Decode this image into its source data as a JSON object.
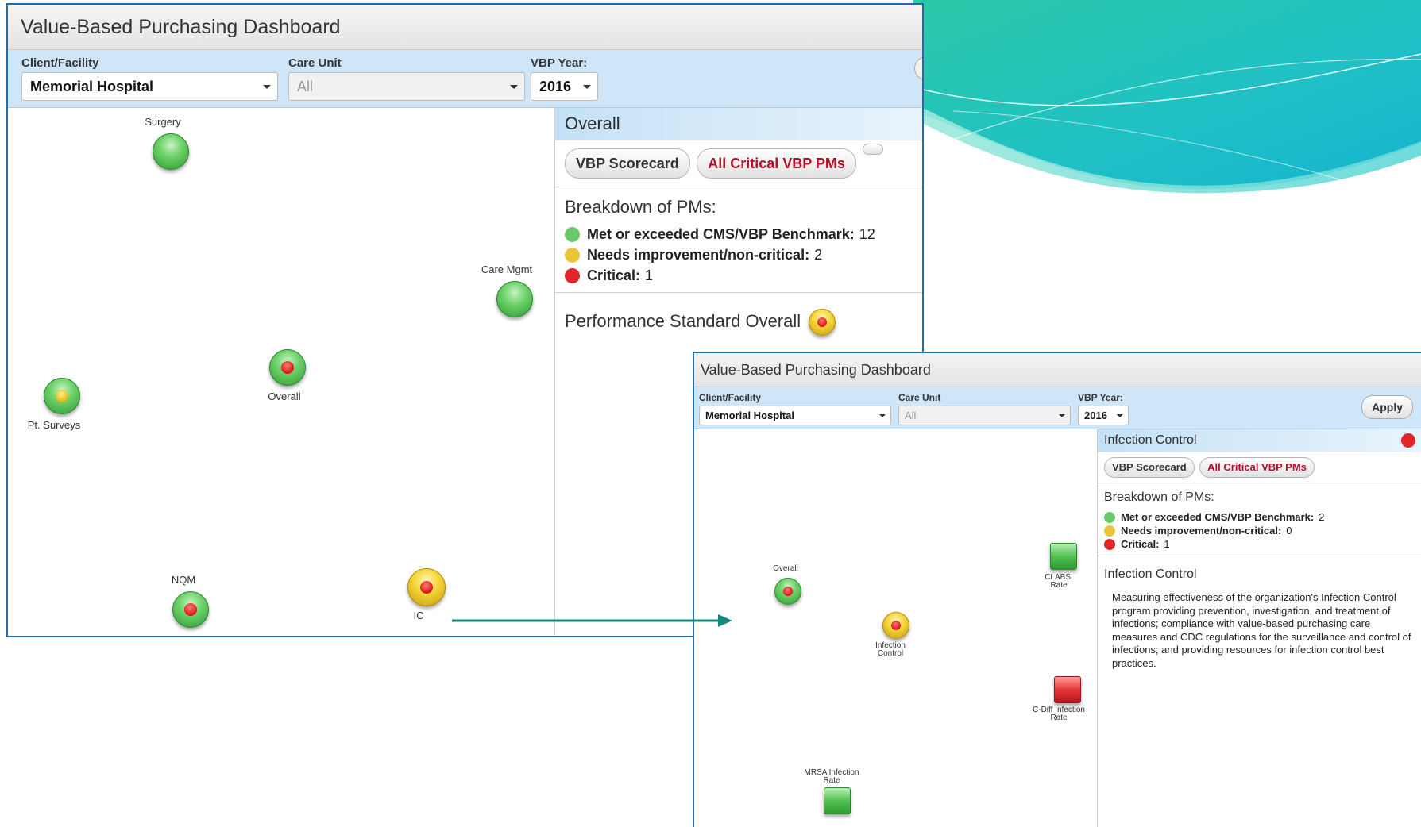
{
  "window1": {
    "title": "Value-Based Purchasing Dashboard",
    "filters": {
      "client_label": "Client/Facility",
      "client_value": "Memorial Hospital",
      "unit_label": "Care Unit",
      "unit_value": "All",
      "year_label": "VBP Year:",
      "year_value": "2016"
    },
    "nodes": [
      {
        "label": "Surgery",
        "status": "green"
      },
      {
        "label": "Care Mgmt",
        "status": "green"
      },
      {
        "label": "Overall",
        "status": "green",
        "inner": "red"
      },
      {
        "label": "Pt. Surveys",
        "status": "green",
        "inner": "yellow"
      },
      {
        "label": "NQM",
        "status": "green",
        "inner": "red"
      },
      {
        "label": "IC",
        "status": "yellow",
        "inner": "red"
      }
    ],
    "side": {
      "heading": "Overall",
      "btn_scorecard": "VBP Scorecard",
      "btn_critical": "All Critical VBP PMs",
      "breakdown_title": "Breakdown of PMs:",
      "met_label": "Met or exceeded CMS/VBP Benchmark:",
      "met_count": "12",
      "needs_label": "Needs improvement/non-critical:",
      "needs_count": "2",
      "critical_label": "Critical:",
      "critical_count": "1",
      "perf_label": "Performance Standard Overall"
    }
  },
  "window2": {
    "title": "Value-Based Purchasing Dashboard",
    "filters": {
      "client_label": "Client/Facility",
      "client_value": "Memorial Hospital",
      "unit_label": "Care Unit",
      "unit_value": "All",
      "year_label": "VBP Year:",
      "year_value": "2016",
      "apply": "Apply"
    },
    "nodes": [
      {
        "label": "Overall",
        "status": "green",
        "inner": "red"
      },
      {
        "label": "Infection Control",
        "status": "yellow",
        "inner": "red"
      },
      {
        "label": "CLABSI Rate",
        "status": "green"
      },
      {
        "label": "C-Diff Infection Rate",
        "status": "red"
      },
      {
        "label": "MRSA Infection Rate",
        "status": "green"
      }
    ],
    "side": {
      "heading": "Infection Control",
      "btn_scorecard": "VBP Scorecard",
      "btn_critical": "All Critical VBP PMs",
      "breakdown_title": "Breakdown of PMs:",
      "met_label": "Met or exceeded CMS/VBP Benchmark:",
      "met_count": "2",
      "needs_label": "Needs improvement/non-critical:",
      "needs_count": "0",
      "critical_label": "Critical:",
      "critical_count": "1",
      "desc_title": "Infection Control",
      "description": "Measuring effectiveness of the organization's Infection Control program providing prevention, investigation, and treatment of infections; compliance with value-based purchasing care measures and CDC regulations for the surveillance and control of infections; and providing resources for infection control best practices."
    }
  },
  "colors": {
    "accent_blue": "#1b6fae",
    "filter_bg": "#cfe6f8",
    "status_green": "#69c96b",
    "status_yellow": "#e9c53a",
    "status_red": "#e0262a",
    "critical_text": "#b5102a",
    "arrow_teal": "#138a7a"
  }
}
